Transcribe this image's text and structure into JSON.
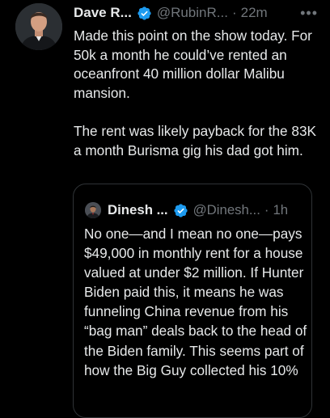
{
  "tweet": {
    "author_name": "Dave R...",
    "handle": "@RubinR...",
    "separator": "·",
    "time": "22m",
    "more_label": "•••",
    "paragraph_1": "Made this point on the show today. For 50k a month he could’ve rented an oceanfront 40 million dollar Malibu mansion.",
    "paragraph_2": "The rent was likely payback for the 83K a month Burisma gig his dad got him."
  },
  "quoted_tweet": {
    "author_name": "Dinesh ...",
    "handle": "@Dinesh...",
    "separator": "·",
    "time": "1h",
    "text": "No one—and I mean no one—pays $49,000 in monthly rent for a house valued at under $2 million. If Hunter Biden paid this, it means he was funneling China revenue from his “bag man” deals back to the head of the Biden family. This seems part of how the Big Guy collected his 10%"
  },
  "colors": {
    "background": "#000000",
    "text_primary": "#e7e9ea",
    "text_secondary": "#71767b",
    "verified_badge": "#1d9bf0",
    "quote_border": "#2f3336"
  },
  "icons": {
    "verified": "verified-badge-icon",
    "more": "more-options-icon"
  }
}
